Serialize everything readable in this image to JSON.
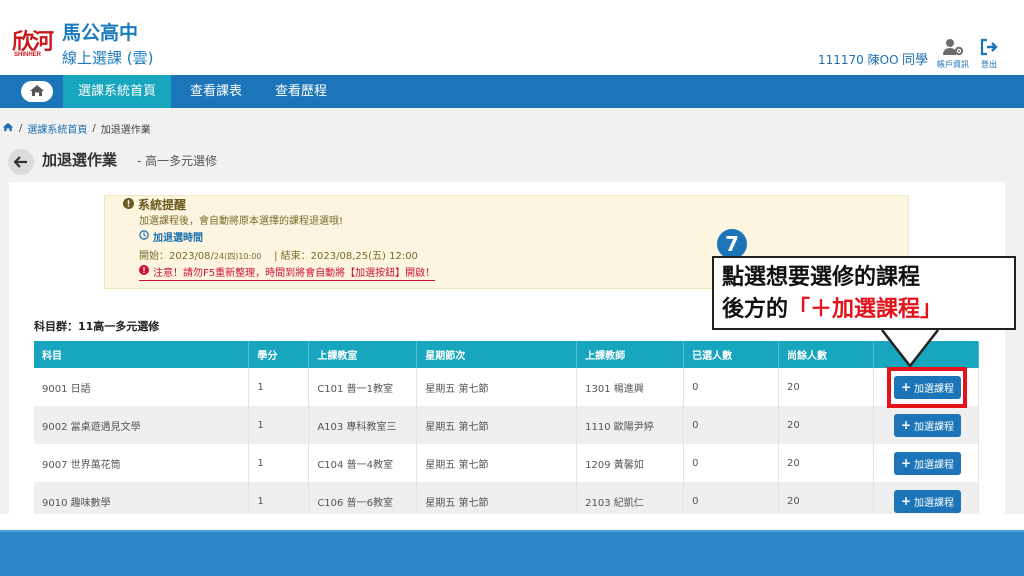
{
  "header": {
    "logo_text": "欣河",
    "logo_sub": "SHINHER",
    "school_name": "馬公高中",
    "app_name": "線上選課 (雲)",
    "user_id": "111170 陳OO",
    "user_role": "同學",
    "account_label": "帳戶資訊",
    "logout_label": "登出"
  },
  "nav": {
    "items": [
      {
        "label": "選課系統首頁"
      },
      {
        "label": "查看課表"
      },
      {
        "label": "查看歷程"
      }
    ]
  },
  "breadcrumb": {
    "items": [
      "選課系統首頁",
      "加退選作業"
    ],
    "separator": "/"
  },
  "page": {
    "title": "加退選作業",
    "subtitle": "- 高一多元選修"
  },
  "alert": {
    "title": "系統提醒",
    "line1": "加選課程後，會自動將原本選擇的課程退選哦!",
    "period_title": "加退選時間",
    "start_prefix": "開始：2023/08/",
    "start_small": "24(四)10:00",
    "end_text": "| 結束：2023/08,25(五) 12:00",
    "warning": "注意！請勿F5重新整理，時間到將會自動將【加選按鈕】開啟！"
  },
  "callout": {
    "step": "7",
    "line1": "點選想要選修的課程",
    "line2_prefix": "後方的",
    "line2_highlight": "「＋加選課程」"
  },
  "table": {
    "group_label": "科目群：11高一多元選修",
    "headers": [
      "科目",
      "學分",
      "上課教室",
      "星期節次",
      "上課教師",
      "已選人數",
      "尚餘人數",
      ""
    ],
    "rows": [
      {
        "subject": "9001 日語",
        "credit": "1",
        "room": "C101 普一1教室",
        "period": "星期五 第七節",
        "teacher": "1301 楊進興",
        "selected": "0",
        "remaining": "20",
        "action": "加選課程"
      },
      {
        "subject": "9002 當桌遊遇見文學",
        "credit": "1",
        "room": "A103 專科教室三",
        "period": "星期五 第七節",
        "teacher": "1110 歐陽尹婷",
        "selected": "0",
        "remaining": "20",
        "action": "加選課程"
      },
      {
        "subject": "9007 世界萬花筒",
        "credit": "1",
        "room": "C104 普一4教室",
        "period": "星期五 第七節",
        "teacher": "1209 黃馨如",
        "selected": "0",
        "remaining": "20",
        "action": "加選課程"
      },
      {
        "subject": "9010 趣味數學",
        "credit": "1",
        "room": "C106 普一6教室",
        "period": "星期五 第七節",
        "teacher": "2103 紀凱仁",
        "selected": "0",
        "remaining": "20",
        "action": "加選課程"
      }
    ]
  },
  "colors": {
    "primary": "#1b75b8",
    "teal": "#17a6bd",
    "highlight_red": "#e3121b",
    "alert_bg": "#fcf6e0"
  }
}
